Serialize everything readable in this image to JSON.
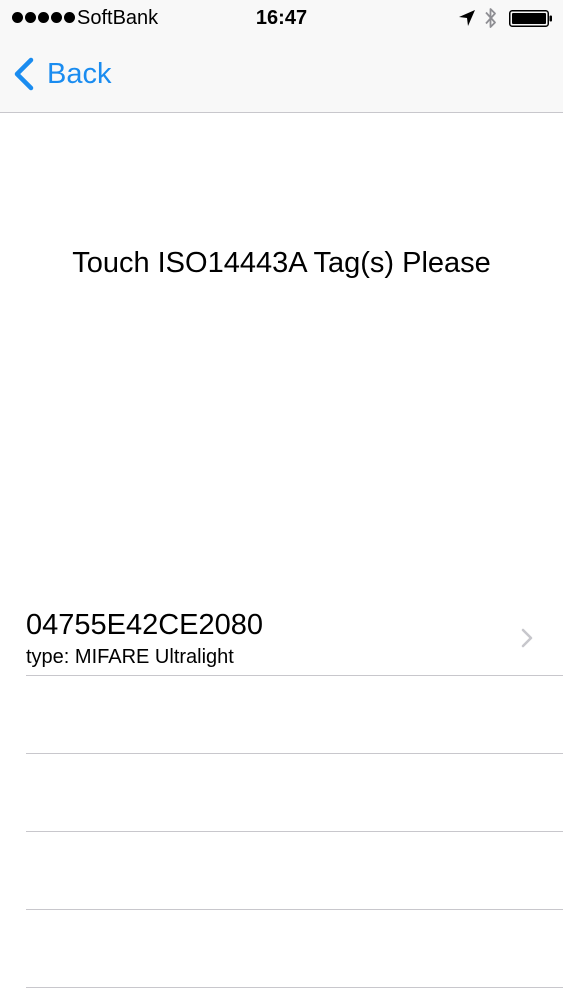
{
  "status_bar": {
    "carrier": "SoftBank",
    "time": "16:47",
    "signal_bars": 5,
    "icons": [
      "location-icon",
      "bluetooth-icon",
      "battery-icon"
    ]
  },
  "nav": {
    "back_label": "Back",
    "accent_color": "#1a8cf0"
  },
  "prompt": "Touch ISO14443A Tag(s) Please",
  "tags": [
    {
      "uid": "04755E42CE2080",
      "type": "type: MIFARE Ultralight"
    }
  ],
  "empty_rows": 4
}
